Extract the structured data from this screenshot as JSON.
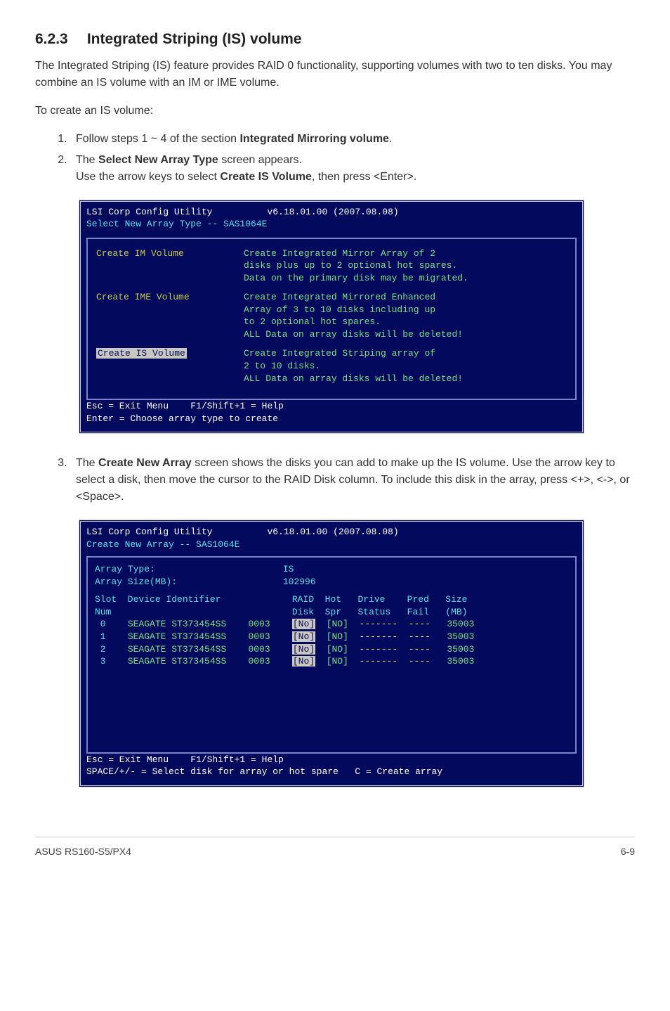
{
  "section": {
    "number": "6.2.3",
    "title": "Integrated Striping (IS) volume"
  },
  "intro": "The Integrated Striping (IS) feature provides RAID 0 functionality, supporting volumes with two to ten disks. You may combine an IS volume with an IM or IME volume.",
  "lead": "To create an IS volume:",
  "steps": {
    "s1_a": "Follow steps 1 ~ 4 of the section ",
    "s1_b": "Integrated Mirroring volume",
    "s1_c": ".",
    "s2_a": "The ",
    "s2_b": "Select New Array Type",
    "s2_c": " screen appears.",
    "s2_d": "Use the arrow keys to select ",
    "s2_e": "Create IS Volume",
    "s2_f": ", then press <Enter>.",
    "s3_a": "The ",
    "s3_b": "Create New Array",
    "s3_c": " screen shows the disks you can add to make up the IS volume. Use the arrow key to select a disk, then move the cursor to the RAID Disk column. To include this disk in the array, press <+>, <->, or <Space>."
  },
  "bios1": {
    "hdr_l": "LSI Corp Config Utility",
    "hdr_r": "v6.18.01.00 (2007.08.08)",
    "hdr2": "Select New Array Type -- SAS1064E",
    "m1": "Create IM Volume",
    "d1": "Create Integrated Mirror Array of 2\ndisks plus up to 2 optional hot spares.\nData on the primary disk may be migrated.",
    "m2": "Create IME Volume",
    "d2": "Create Integrated Mirrored Enhanced\nArray of 3 to 10 disks including up\nto 2 optional hot spares.\nALL Data on array disks will be deleted!",
    "m3": "Create IS Volume",
    "d3": "Create Integrated Striping array of\n2 to 10 disks.\nALL Data on array disks will be deleted!",
    "foot": "Esc = Exit Menu    F1/Shift+1 = Help\nEnter = Choose array type to create"
  },
  "bios2": {
    "hdr_l": "LSI Corp Config Utility",
    "hdr_r": "v6.18.01.00 (2007.08.08)",
    "hdr2": "Create New Array -- SAS1064E",
    "info_l1a": "Array Type:",
    "info_l1b": "IS",
    "info_l2a": "Array Size(MB):",
    "info_l2b": "102996",
    "head": "Slot  Device Identifier             RAID  Hot   Drive    Pred   Size",
    "head2": "Num                                 Disk  Spr   Status   Fail   (MB)",
    "rows": [
      {
        "slot": " 0",
        "dev": "SEAGATE ST373454SS",
        "rev": "0003",
        "raid": "[No]",
        "spr": "[NO]",
        "status": "-------",
        "fail": "----",
        "size": "35003"
      },
      {
        "slot": " 1",
        "dev": "SEAGATE ST373454SS",
        "rev": "0003",
        "raid": "[No]",
        "spr": "[NO]",
        "status": "-------",
        "fail": "----",
        "size": "35003"
      },
      {
        "slot": " 2",
        "dev": "SEAGATE ST373454SS",
        "rev": "0003",
        "raid": "[No]",
        "spr": "[NO]",
        "status": "-------",
        "fail": "----",
        "size": "35003"
      },
      {
        "slot": " 3",
        "dev": "SEAGATE ST373454SS",
        "rev": "0003",
        "raid": "[No]",
        "spr": "[NO]",
        "status": "-------",
        "fail": "----",
        "size": "35003"
      }
    ],
    "foot": "Esc = Exit Menu    F1/Shift+1 = Help\nSPACE/+/- = Select disk for array or hot spare   C = Create array"
  },
  "footer": {
    "left": "ASUS RS160-S5/PX4",
    "right": "6-9"
  }
}
